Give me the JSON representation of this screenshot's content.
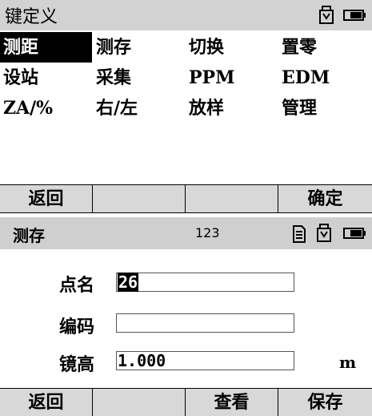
{
  "top_panel": {
    "title": "键定义",
    "keys": [
      [
        "测距",
        "测存",
        "切换",
        "置零"
      ],
      [
        "设站",
        "采集",
        "PPM",
        "EDM"
      ],
      [
        "ZA/%",
        "右/左",
        "放样",
        "管理"
      ]
    ],
    "softkeys": [
      "返回",
      "",
      "",
      "确定"
    ]
  },
  "bottom_panel": {
    "title": "测存",
    "mode": "123",
    "fields": [
      {
        "label": "点名",
        "value": "26"
      },
      {
        "label": "编码",
        "value": ""
      },
      {
        "label": "镜高",
        "value": "1.000",
        "unit": "m"
      }
    ],
    "softkeys": [
      "返回",
      "",
      "查看",
      "保存"
    ]
  },
  "icons": {
    "usb": "usb-icon",
    "battery": "battery-icon",
    "memory": "memory-card-icon"
  }
}
